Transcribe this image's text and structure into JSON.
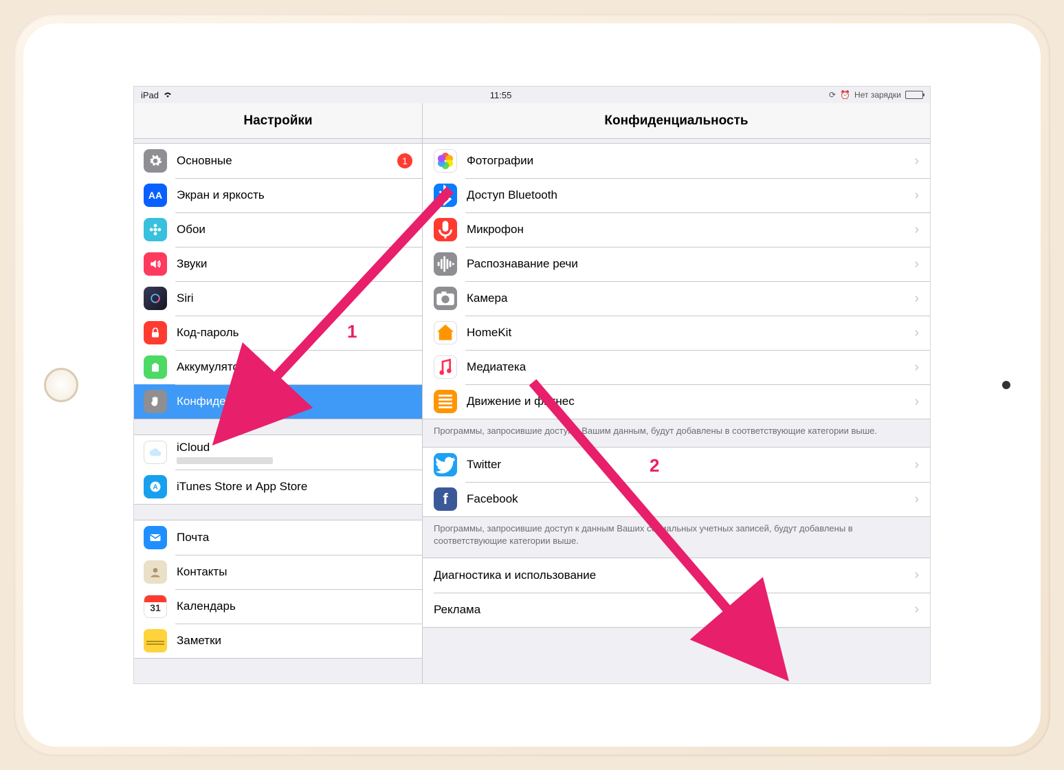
{
  "statusbar": {
    "device": "iPad",
    "time": "11:55",
    "right_text": "Нет зарядки"
  },
  "sidebar": {
    "title": "Настройки",
    "groups": [
      {
        "items": [
          {
            "id": "general",
            "label": "Основные",
            "badge": "1",
            "icon": "gear",
            "bg": "#8e8e93"
          },
          {
            "id": "display",
            "label": "Экран и яркость",
            "icon": "aa",
            "bg": "#0a60ff"
          },
          {
            "id": "wallpaper",
            "label": "Обои",
            "icon": "flower",
            "bg": "#38c0de"
          },
          {
            "id": "sounds",
            "label": "Звуки",
            "icon": "speaker",
            "bg": "#ff3a5f"
          },
          {
            "id": "siri",
            "label": "Siri",
            "icon": "siri",
            "bg": "#222"
          },
          {
            "id": "passcode",
            "label": "Код-пароль",
            "icon": "lock",
            "bg": "#ff3b30"
          },
          {
            "id": "battery",
            "label": "Аккумулятор",
            "icon": "battery",
            "bg": "#4cd964"
          },
          {
            "id": "privacy",
            "label": "Конфиденциальность",
            "icon": "hand",
            "bg": "#8e8e93",
            "selected": true
          }
        ]
      },
      {
        "items": [
          {
            "id": "icloud",
            "label": "iCloud",
            "icon": "cloud",
            "bg": "#ffffff",
            "hasSub": true
          },
          {
            "id": "appstore",
            "label": "iTunes Store и App Store",
            "icon": "appstore",
            "bg": "#17a0ee"
          }
        ]
      },
      {
        "items": [
          {
            "id": "mail",
            "label": "Почта",
            "icon": "mail",
            "bg": "#1f8fff"
          },
          {
            "id": "contacts",
            "label": "Контакты",
            "icon": "contacts",
            "bg": "#d8c4a2"
          },
          {
            "id": "calendar",
            "label": "Календарь",
            "icon": "calendar",
            "bg": "#ffffff"
          },
          {
            "id": "notes",
            "label": "Заметки",
            "icon": "notes",
            "bg": "#ffd33c"
          }
        ]
      }
    ]
  },
  "detail": {
    "title": "Конфиденциальность",
    "sections": [
      {
        "items": [
          {
            "id": "photos",
            "label": "Фотографии",
            "icon": "photos",
            "bg": "#fff"
          },
          {
            "id": "bluetooth",
            "label": "Доступ Bluetooth",
            "icon": "bt",
            "bg": "#0a7cff"
          },
          {
            "id": "microphone",
            "label": "Микрофон",
            "icon": "mic",
            "bg": "#ff3b30"
          },
          {
            "id": "speech",
            "label": "Распознавание речи",
            "icon": "wave",
            "bg": "#8e8e93"
          },
          {
            "id": "camera",
            "label": "Камера",
            "icon": "camera",
            "bg": "#8e8e93"
          },
          {
            "id": "homekit",
            "label": "HomeKit",
            "icon": "home",
            "bg": "#fff"
          },
          {
            "id": "media",
            "label": "Медиатека",
            "icon": "music",
            "bg": "#fff"
          },
          {
            "id": "motion",
            "label": "Движение и фитнес",
            "icon": "motion",
            "bg": "#ff9500"
          }
        ],
        "footer": "Программы, запросившие доступ к Вашим данным, будут добавлены в соответствующие категории выше."
      },
      {
        "items": [
          {
            "id": "twitter",
            "label": "Twitter",
            "icon": "twitter",
            "bg": "#1da1f2"
          },
          {
            "id": "facebook",
            "label": "Facebook",
            "icon": "facebook",
            "bg": "#3b5998"
          }
        ],
        "footer": "Программы, запросившие доступ к данным Ваших социальных учетных записей, будут добавлены в соответствующие категории выше."
      },
      {
        "items": [
          {
            "id": "diag",
            "label": "Диагностика и использование",
            "plain": true
          },
          {
            "id": "ads",
            "label": "Реклама",
            "plain": true
          }
        ]
      }
    ]
  },
  "annotations": {
    "a1": "1",
    "a2": "2"
  }
}
